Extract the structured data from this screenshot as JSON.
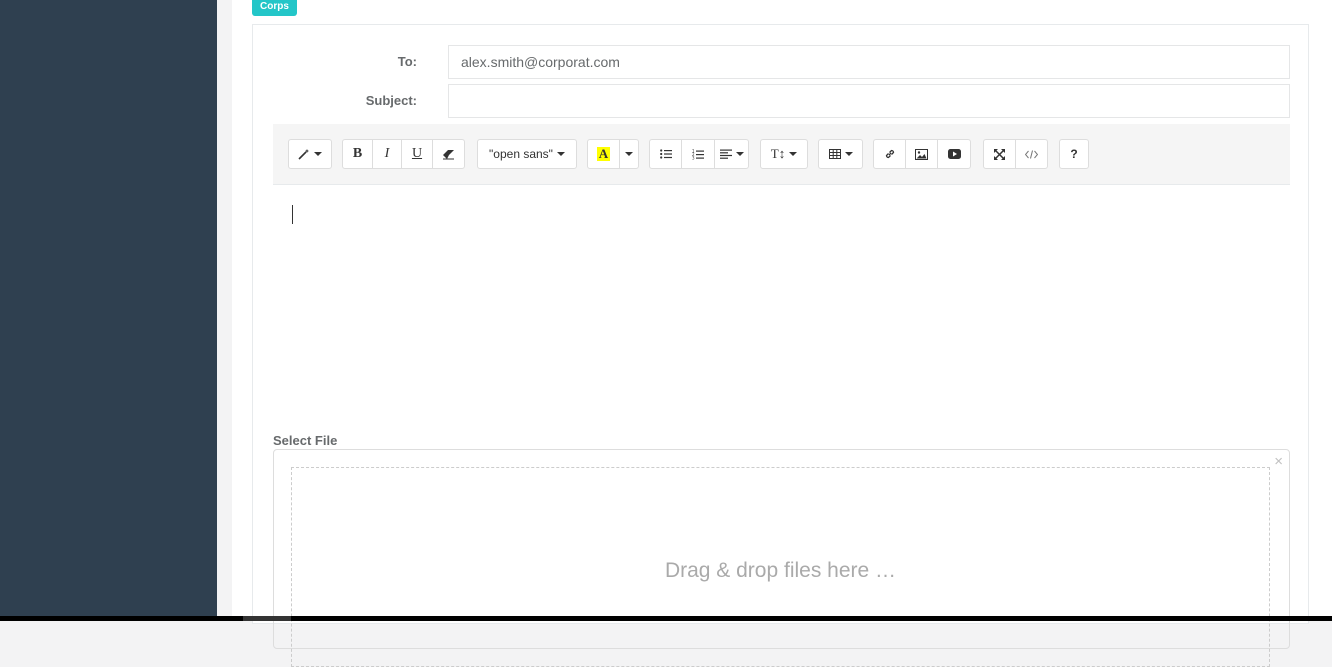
{
  "badge": "Corps",
  "form": {
    "to_label": "To:",
    "to_value": "alex.smith@corporat.com",
    "subject_label": "Subject:",
    "subject_value": ""
  },
  "toolbar": {
    "style_icon": "magic-wand-icon",
    "bold": "B",
    "italic": "I",
    "underline": "U",
    "eraser_icon": "eraser-icon",
    "font_name": "\"open sans\"",
    "color_letter": "A",
    "highlight_color": "#ffff00",
    "list_ul_icon": "unordered-list-icon",
    "list_ol_icon": "ordered-list-icon",
    "align_icon": "align-left-icon",
    "height_label": "T↕",
    "table_icon": "table-icon",
    "link_icon": "link-icon",
    "image_icon": "image-icon",
    "video_icon": "video-icon",
    "fullscreen_icon": "fullscreen-icon",
    "codeview_icon": "code-view-icon",
    "help": "?"
  },
  "file": {
    "label": "Select File",
    "drop_text": "Drag & drop files here …",
    "close": "×"
  },
  "colors": {
    "sidebar": "#2f4050",
    "badge": "#23c6c8"
  }
}
